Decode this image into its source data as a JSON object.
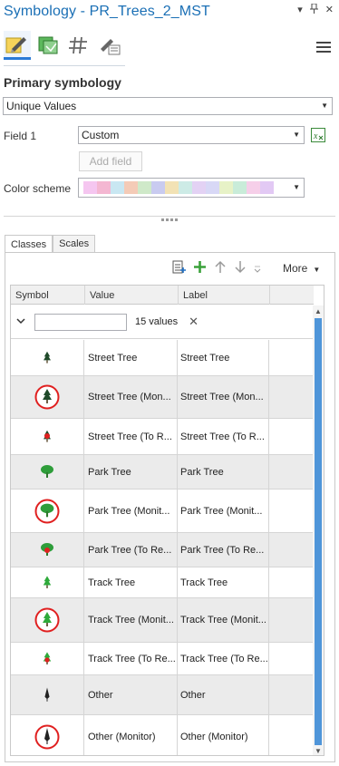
{
  "pane": {
    "title": "Symbology - PR_Trees_2_MST",
    "controls": [
      "▾",
      "⊓",
      "✕"
    ]
  },
  "primary": {
    "section_title": "Primary symbology",
    "symbology_type": "Unique Values",
    "field1_label": "Field 1",
    "field1_value": "Custom",
    "add_field_label": "Add field",
    "color_scheme_label": "Color scheme",
    "color_scheme": [
      "#f5c6f0",
      "#f4b7d2",
      "#c9e7f2",
      "#f4cbb7",
      "#cfe9c9",
      "#c9cbf0",
      "#f2e2b5",
      "#cdebe6",
      "#e3d2f4",
      "#d8d8f6",
      "#e7f2c7",
      "#c9ecd9",
      "#f6cfe9",
      "#e2c9f4"
    ]
  },
  "tabs": [
    {
      "label": "Classes",
      "active": true
    },
    {
      "label": "Scales",
      "active": false
    }
  ],
  "classes_toolbar": {
    "more_label": "More"
  },
  "grid": {
    "headers": [
      "Symbol",
      "Value",
      "Label",
      ""
    ],
    "filter_placeholder": "",
    "values_count": "15 values",
    "rows": [
      {
        "symbol": "tree-black-small",
        "value": "Street Tree",
        "label": "Street Tree",
        "h": 40,
        "alt": false
      },
      {
        "symbol": "tree-black-monitor",
        "value": "Street Tree (Mon...",
        "label": "Street Tree (Mon...",
        "h": 47,
        "alt": true
      },
      {
        "symbol": "tree-black-remove",
        "value": "Street Tree (To R...",
        "label": "Street Tree (To R...",
        "h": 40,
        "alt": false
      },
      {
        "symbol": "tree-round-green",
        "value": "Park Tree",
        "label": "Park Tree",
        "h": 38,
        "alt": true
      },
      {
        "symbol": "tree-round-green-monitor",
        "value": "Park Tree (Monit...",
        "label": "Park Tree (Monit...",
        "h": 48,
        "alt": false
      },
      {
        "symbol": "tree-round-green-remove",
        "value": "Park Tree (To Re...",
        "label": "Park Tree (To Re...",
        "h": 38,
        "alt": true
      },
      {
        "symbol": "tree-green-small",
        "value": "Track Tree",
        "label": "Track Tree",
        "h": 34,
        "alt": false
      },
      {
        "symbol": "tree-green-monitor",
        "value": "Track Tree (Monit...",
        "label": "Track Tree (Monit...",
        "h": 49,
        "alt": true
      },
      {
        "symbol": "tree-green-remove",
        "value": "Track Tree (To Re...",
        "label": "Track Tree (To Re...",
        "h": 36,
        "alt": false
      },
      {
        "symbol": "other-black",
        "value": "Other",
        "label": "Other",
        "h": 44,
        "alt": true
      },
      {
        "symbol": "other-black-monitor",
        "value": "Other (Monitor)",
        "label": "Other (Monitor)",
        "h": 48,
        "alt": false
      },
      {
        "symbol": "",
        "value": "",
        "label": "",
        "h": 20,
        "alt": true
      }
    ]
  }
}
